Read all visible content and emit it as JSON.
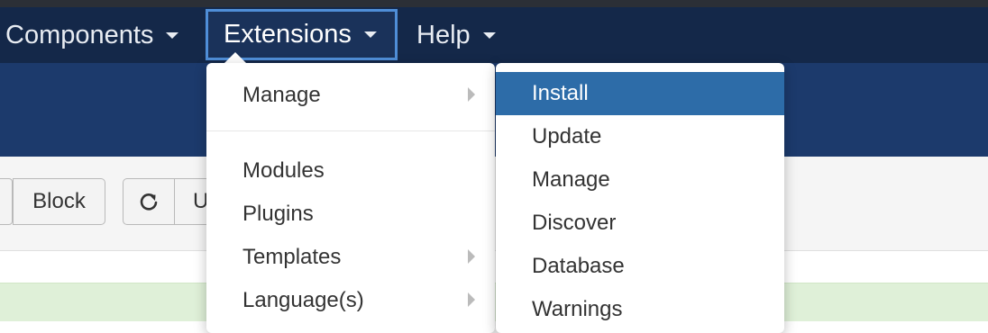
{
  "nav": {
    "components": "Components",
    "extensions": "Extensions",
    "help": "Help"
  },
  "toolbar": {
    "block": "Block",
    "refresh_icon": "refresh-icon",
    "unblock_partial": "U"
  },
  "extensions_menu": {
    "items": [
      "Manage",
      "Modules",
      "Plugins",
      "Templates",
      "Language(s)"
    ]
  },
  "manage_submenu": {
    "items": [
      "Install",
      "Update",
      "Manage",
      "Discover",
      "Database",
      "Warnings"
    ],
    "active": "Install"
  },
  "colors": {
    "navbar": "#142849",
    "subheader": "#1c3a6c",
    "active_item": "#2d6ca8",
    "success_band": "#dff0d8"
  }
}
